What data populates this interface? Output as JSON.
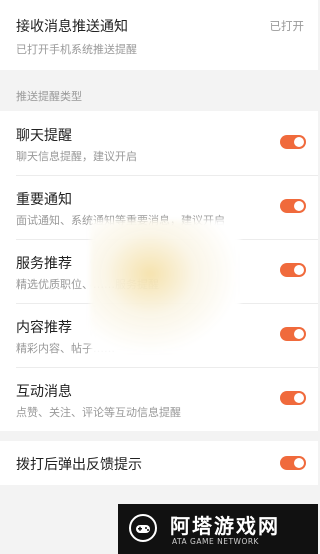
{
  "push": {
    "title": "接收消息推送通知",
    "subtitle": "已打开手机系统推送提醒",
    "status": "已打开"
  },
  "section_label": "推送提醒类型",
  "items": [
    {
      "title": "聊天提醒",
      "subtitle": "聊天信息提醒，建议开启",
      "enabled": true
    },
    {
      "title": "重要通知",
      "subtitle": "面试通知、系统通知等重要消息，建议开启",
      "enabled": true
    },
    {
      "title": "服务推荐",
      "subtitle": "精选优质职位、……服务提醒",
      "enabled": true
    },
    {
      "title": "内容推荐",
      "subtitle": "精彩内容、帖子……",
      "enabled": true
    },
    {
      "title": "互动消息",
      "subtitle": "点赞、关注、评论等互动信息提醒",
      "enabled": true
    }
  ],
  "feedback": {
    "title": "拨打后弹出反馈提示",
    "enabled": true
  },
  "accent_color": "#f06a3c",
  "watermark": {
    "name": "阿塔游戏网",
    "subtitle": "ATA GAME NETWORK"
  }
}
